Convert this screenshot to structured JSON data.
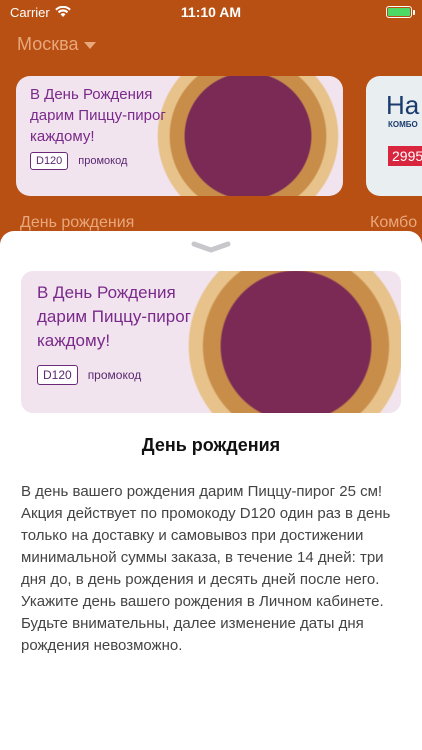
{
  "status": {
    "carrier": "Carrier",
    "time": "11:10 AM",
    "battery_level": 1.0
  },
  "header": {
    "city": "Москва"
  },
  "promos": [
    {
      "line1": "В День Рождения",
      "line2": "дарим Пиццу-пирог",
      "line3": "каждому!",
      "code": "D120",
      "code_label": "промокод",
      "caption": "День рождения"
    },
    {
      "big": "На",
      "small": "КОМБО",
      "price": "2995",
      "caption": "Комбо"
    }
  ],
  "sheet": {
    "banner": {
      "line1": "В День Рождения",
      "line2": "дарим Пиццу-пирог",
      "line3": "каждому!",
      "code": "D120",
      "code_label": "промокод"
    },
    "title": "День рождения",
    "description": "В день вашего рождения дарим Пиццу-пирог 25 см! Акция действует по промокоду D120 один раз в день только на доставку и самовывоз при достижении минимальной суммы заказа, в течение 14 дней: три дня до, в день рождения и десять дней после него. Укажите день вашего рождения в Личном кабинете. Будьте внимательны, далее изменение даты дня рождения невозможно."
  }
}
